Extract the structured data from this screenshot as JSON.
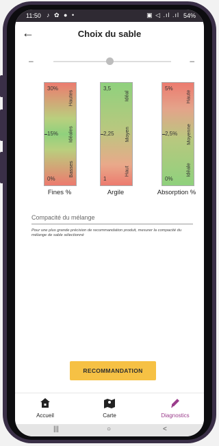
{
  "status_bar": {
    "time": "11:50",
    "left_icons": "♪ ✿ ● •",
    "right_icons": "▣ ◁ .ıl .ıl",
    "battery": "54%"
  },
  "app_bar": {
    "title": "Choix du sable"
  },
  "slider": {
    "minus": "–",
    "plus": "–",
    "value": 0.5
  },
  "gauges": [
    {
      "label": "Fines %",
      "ticks": [
        "30%",
        "15%",
        "0%"
      ],
      "zones": [
        "Hautes",
        "Idéales",
        "Basses"
      ]
    },
    {
      "label": "Argile",
      "ticks": [
        "3,5",
        "2,25",
        "1"
      ],
      "zones": [
        "Idéal",
        "Moyen",
        "Haut"
      ]
    },
    {
      "label": "Absorption %",
      "ticks": [
        "5%",
        "2,5%",
        "0%"
      ],
      "zones": [
        "Haute",
        "Moyenne",
        "Idéale"
      ]
    }
  ],
  "compactness": {
    "label": "Compacité du mélange",
    "note": "Pour une plus grande précision de recommandation produit, mesurer la compacité du mélange de sable sélectionné"
  },
  "recommendation_button": "RECOMMANDATION",
  "bottom_nav": [
    {
      "label": "Accueil",
      "icon": "home-icon"
    },
    {
      "label": "Carte",
      "icon": "map-icon"
    },
    {
      "label": "Diagnostics",
      "icon": "pen-icon",
      "active": true
    }
  ],
  "colors": {
    "accent": "#9b3d8c",
    "button": "#f6c144",
    "red": "#ec7b6f",
    "green": "#8fd17d"
  },
  "system_nav": {
    "recents": "|||",
    "home": "○",
    "back": "<"
  }
}
